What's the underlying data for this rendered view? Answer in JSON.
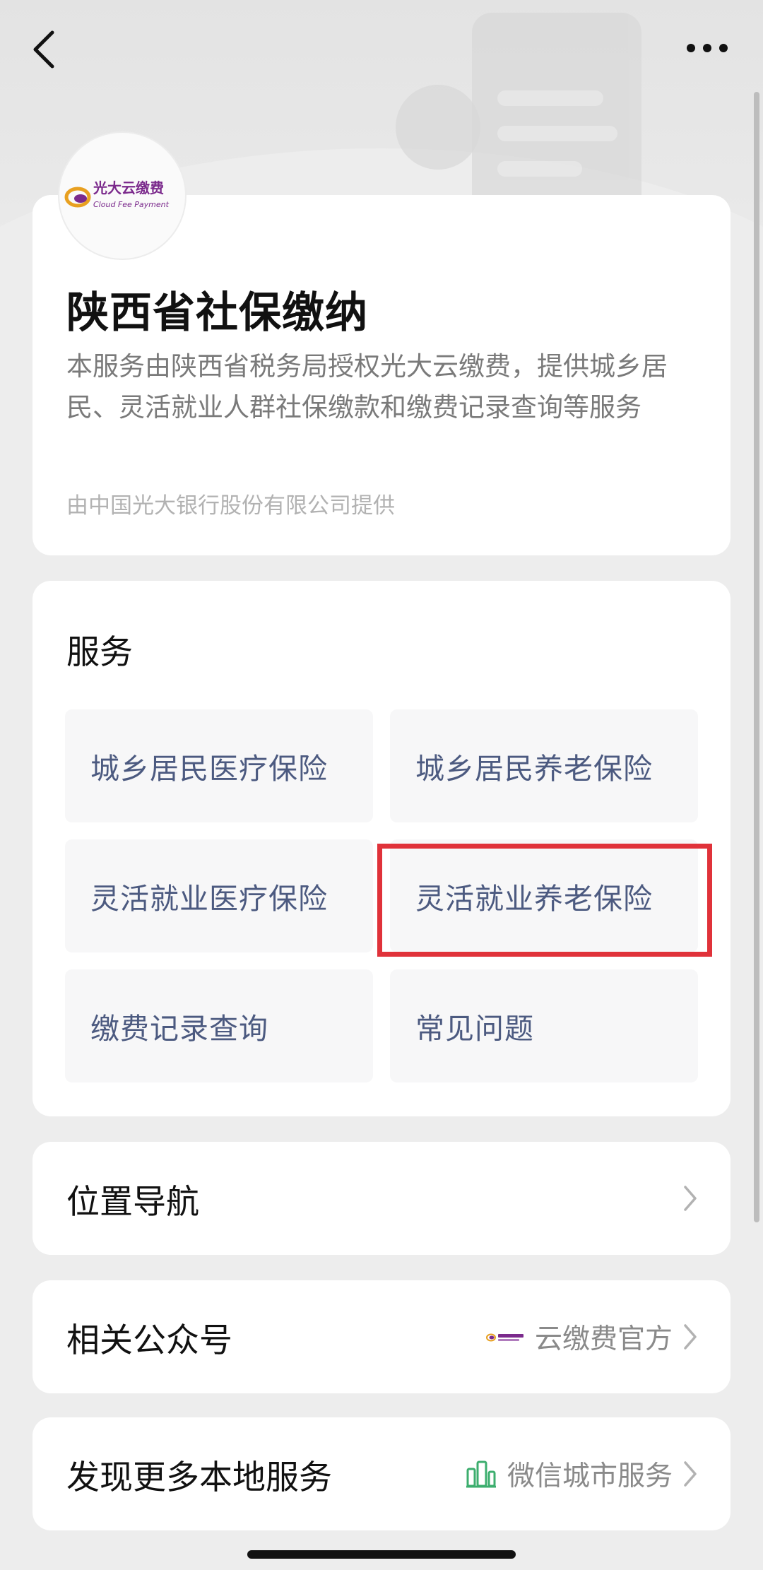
{
  "logo": {
    "cn": "光大云缴费",
    "en": "Cloud Fee Payment",
    "name": "cloud-fee-payment-logo"
  },
  "header": {
    "title": "陕西省社保缴纳",
    "description": "本服务由陕西省税务局授权光大云缴费，提供城乡居民、灵活就业人群社保缴款和缴费记录查询等服务",
    "provider": "由中国光大银行股份有限公司提供"
  },
  "services": {
    "title": "服务",
    "items": [
      {
        "label": "城乡居民医疗保险"
      },
      {
        "label": "城乡居民养老保险"
      },
      {
        "label": "灵活就业医疗保险"
      },
      {
        "label": "灵活就业养老保险",
        "highlighted": true
      },
      {
        "label": "缴费记录查询"
      },
      {
        "label": "常见问题"
      }
    ],
    "highlight_color": "#e0323a"
  },
  "location_nav": {
    "label": "位置导航"
  },
  "related_account": {
    "label": "相关公众号",
    "value": "云缴费官方",
    "value_icon": "cloud-fee-mini-logo"
  },
  "more_services": {
    "label": "发现更多本地服务",
    "value": "微信城市服务",
    "value_icon": "city-services-icon"
  },
  "colors": {
    "accent_text": "#4c5a80",
    "page_bg": "#ededed",
    "highlight": "#e0323a"
  }
}
